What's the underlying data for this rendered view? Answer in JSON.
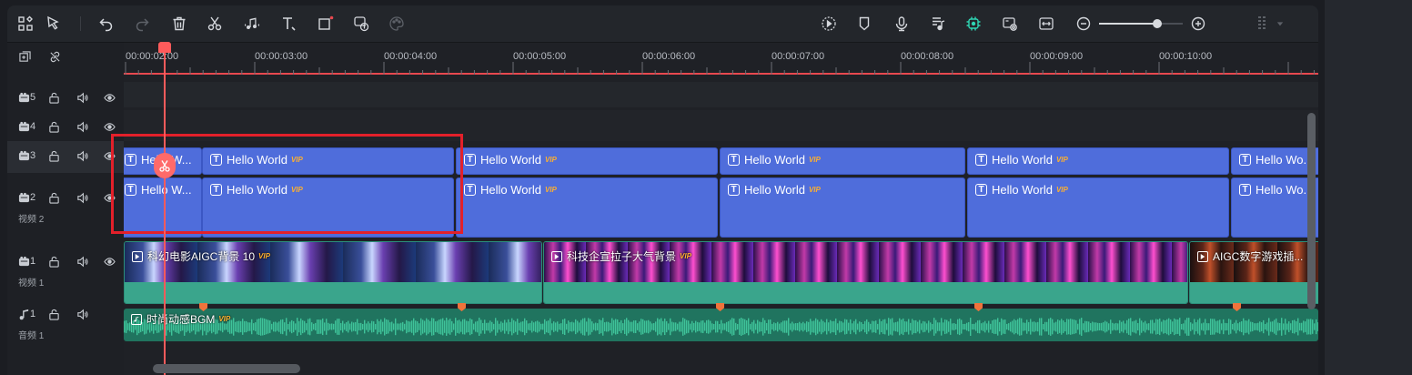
{
  "toolbar": {
    "left_icons": [
      "layout-icon",
      "pointer-select-icon",
      "undo-icon",
      "redo-icon",
      "delete-icon",
      "split-icon",
      "audio-split-icon",
      "text-icon",
      "crop-icon",
      "speech-to-text-icon",
      "color-palette-icon"
    ],
    "right_icons": [
      "render-preview-icon",
      "marker-icon",
      "microphone-icon",
      "audio-track-icon",
      "ai-auto-icon",
      "snapshot-icon",
      "fit-timeline-icon"
    ],
    "zoom_level": 0.7
  },
  "ruler": {
    "ticks": [
      "00:00:02:00",
      "00:00:03:00",
      "00:00:04:00",
      "00:00:05:00",
      "00:00:06:00",
      "00:00:07:00",
      "00:00:08:00",
      "00:00:09:00",
      "00:00:10:00"
    ]
  },
  "tracks": {
    "v5": {
      "number": "5"
    },
    "v4": {
      "number": "4"
    },
    "v3": {
      "number": "3"
    },
    "v2": {
      "number": "2",
      "label": "视频 2"
    },
    "v1": {
      "number": "1",
      "label": "视频 1"
    },
    "a1": {
      "number": "1",
      "label": "音频 1"
    }
  },
  "text_clips": {
    "row3": [
      {
        "title": "Hello W...",
        "vip": ""
      },
      {
        "title": "Hello World",
        "vip": "VIP"
      },
      {
        "title": "Hello World",
        "vip": "VIP"
      },
      {
        "title": "Hello World",
        "vip": "VIP"
      },
      {
        "title": "Hello World",
        "vip": "VIP"
      },
      {
        "title": "Hello Wo...",
        "vip": ""
      }
    ],
    "row2": [
      {
        "title": "Hello W...",
        "vip": ""
      },
      {
        "title": "Hello World",
        "vip": "VIP"
      },
      {
        "title": "Hello World",
        "vip": "VIP"
      },
      {
        "title": "Hello World",
        "vip": "VIP"
      },
      {
        "title": "Hello World",
        "vip": "VIP"
      },
      {
        "title": "Hello Wo...",
        "vip": ""
      }
    ]
  },
  "video_clips": [
    {
      "title": "科幻电影AIGC背景 10",
      "vip": "VIP"
    },
    {
      "title": "科技企宣拉子大气背景",
      "vip": "VIP"
    },
    {
      "title": "AIGC数字游戏插...",
      "vip": ""
    }
  ],
  "audio_clip": {
    "title": "时尚动感BGM",
    "vip": "VIP"
  },
  "colors": {
    "accent": "#2fd6b4",
    "playhead": "#ff5b5b",
    "text_clip": "#4f6ddb",
    "video_clip_bottom": "#3aa58c",
    "audio_wave": "#3fc39a",
    "highlight": "#e3202a"
  }
}
